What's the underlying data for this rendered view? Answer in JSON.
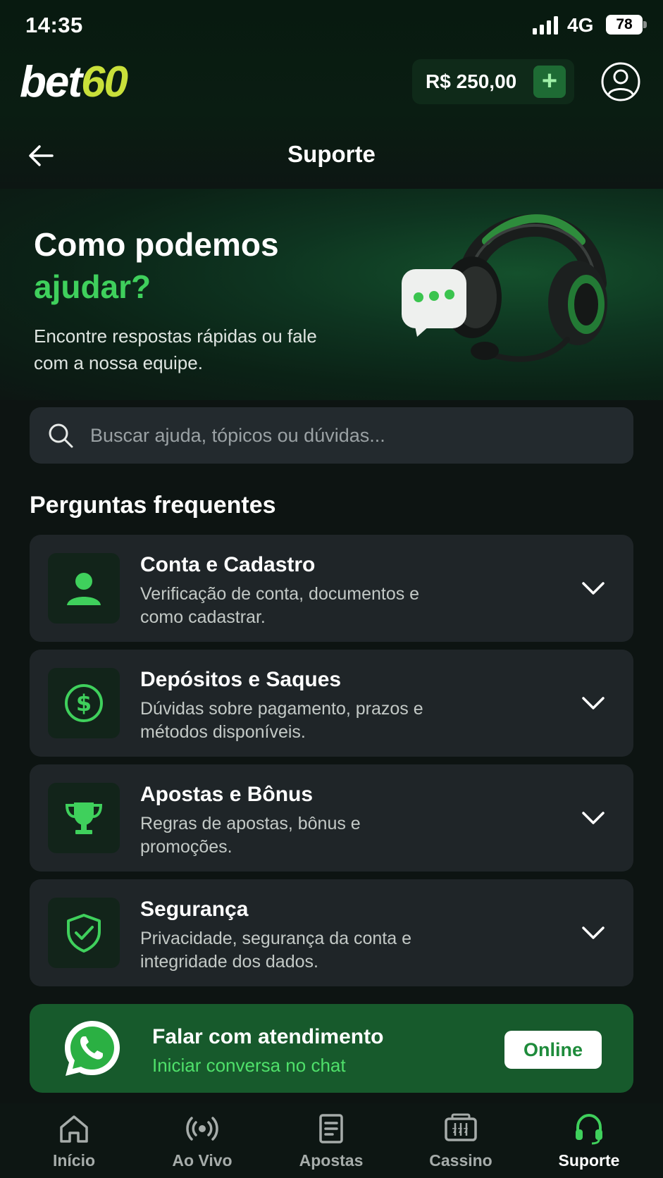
{
  "status_bar": {
    "time": "14:35",
    "network": "4G",
    "battery": "78"
  },
  "header": {
    "logo_main": "bet",
    "logo_accent": "60",
    "balance": "R$ 250,00",
    "add_funds_label": "+",
    "brand_accent_color": "#c9e03a"
  },
  "nav": {
    "title": "Suporte"
  },
  "hero": {
    "title_line1": "Como podemos",
    "title_line2": "ajudar?",
    "subtitle": "Encontre respostas rápidas ou fale com a nossa equipe.",
    "accent_color": "#3fd05c"
  },
  "search": {
    "placeholder": "Buscar ajuda, tópicos ou dúvidas..."
  },
  "faq": {
    "title": "Perguntas frequentes",
    "items": [
      {
        "title": "Conta e Cadastro",
        "description": "Verificação de conta, documentos e como cadastrar.",
        "icon": "person-icon"
      },
      {
        "title": "Depósitos e Saques",
        "description": "Dúvidas sobre pagamento, prazos e métodos disponíveis.",
        "icon": "dollar-circle-icon"
      },
      {
        "title": "Apostas e Bônus",
        "description": "Regras de apostas, bônus e promoções.",
        "icon": "trophy-icon"
      },
      {
        "title": "Segurança",
        "description": "Privacidade, segurança da conta e integridade dos dados.",
        "icon": "shield-check-icon"
      }
    ]
  },
  "chat": {
    "title": "Falar com atendimento",
    "subtitle": "Iniciar conversa no chat",
    "status": "Online",
    "icon": "whatsapp-icon"
  },
  "tabbar": {
    "items": [
      {
        "label": "Início",
        "icon": "home-icon",
        "active": false
      },
      {
        "label": "Ao Vivo",
        "icon": "live-broadcast-icon",
        "active": false
      },
      {
        "label": "Apostas",
        "icon": "bet-slip-icon",
        "active": false
      },
      {
        "label": "Cassino",
        "icon": "slot-machine-icon",
        "active": false
      },
      {
        "label": "Suporte",
        "icon": "headset-icon",
        "active": true
      }
    ]
  }
}
